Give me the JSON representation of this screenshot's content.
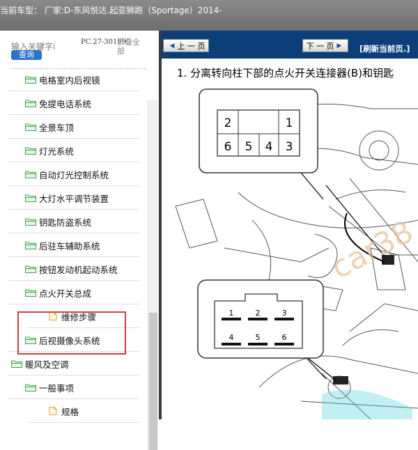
{
  "window": {
    "title": "当前车型： 厂家:D-东风悦达.起亚狮跑（Sportage）2014-"
  },
  "sidebar": {
    "search_placeholder": "输入关键字i",
    "search_button": "查询",
    "code": "PC.27-30199",
    "collapse": "折叠全部",
    "items": [
      {
        "label": "电格室内后视镜",
        "icon": "folder-open",
        "level": 1
      },
      {
        "label": "免提电话系统",
        "icon": "folder-open",
        "level": 1
      },
      {
        "label": "全景车顶",
        "icon": "folder-open",
        "level": 1
      },
      {
        "label": "灯光系统",
        "icon": "folder-open",
        "level": 1
      },
      {
        "label": "自动灯光控制系统",
        "icon": "folder-open",
        "level": 1
      },
      {
        "label": "大灯水平调节装置",
        "icon": "folder-open",
        "level": 1
      },
      {
        "label": "钥匙防盗系统",
        "icon": "folder-open",
        "level": 1
      },
      {
        "label": "后驻车辅助系统",
        "icon": "folder-open",
        "level": 1
      },
      {
        "label": "按钮发动机起动系统",
        "icon": "folder-open",
        "level": 1
      },
      {
        "label": "点火开关总成",
        "icon": "folder-open",
        "level": 1
      },
      {
        "label": "维修步骤",
        "icon": "page",
        "level": 2
      },
      {
        "label": "后视摄像头系统",
        "icon": "folder-open",
        "level": 1
      },
      {
        "label": "暖风及空调",
        "icon": "folder-open",
        "level": 0
      },
      {
        "label": "一般事项",
        "icon": "folder-open",
        "level": 1
      },
      {
        "label": "规格",
        "icon": "page",
        "level": 2
      }
    ]
  },
  "viewer": {
    "prev_label": "上 一 页",
    "next_label": "下 一 页",
    "refresh_label": "[刷新当前页.]",
    "step_text": "1. 分离转向柱下部的点火开关连接器(B)和钥匙",
    "connector_top": {
      "pins_row1": [
        "2",
        "",
        "",
        "1"
      ],
      "pins_row2": [
        "6",
        "5",
        "4",
        "3"
      ]
    },
    "connector_bottom": {
      "pins_row1": [
        "1",
        "2",
        "3"
      ],
      "pins_row2": [
        "4",
        "5",
        "6"
      ]
    },
    "watermark": "car38",
    "colors": {
      "toolbar": "#0c3f7a",
      "highlight": "#d23a3a",
      "folder": "#3aa34a",
      "page": "#e8a030"
    }
  }
}
